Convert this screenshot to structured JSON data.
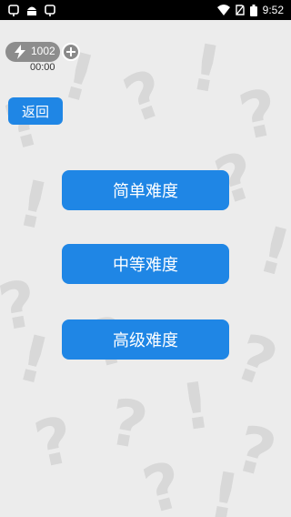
{
  "status_bar": {
    "time": "9:52",
    "icons": [
      "app-icon",
      "android-icon",
      "app-icon",
      "wifi-icon",
      "no-sim-icon",
      "battery-icon"
    ]
  },
  "energy": {
    "value": "1002",
    "timer": "00:00"
  },
  "back_label": "返回",
  "levels": [
    {
      "label": "简单难度"
    },
    {
      "label": "中等难度"
    },
    {
      "label": "高级难度"
    }
  ],
  "colors": {
    "primary_button": "#1f86e5",
    "background": "#ececec",
    "pattern": "#d6d6d6"
  }
}
